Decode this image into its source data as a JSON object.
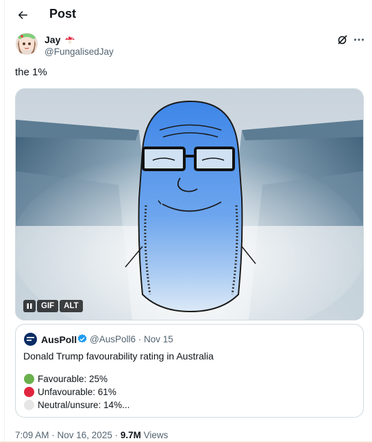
{
  "header": {
    "title": "Post"
  },
  "post": {
    "author": {
      "display_name": "Jay",
      "name_emoji": "mushroom",
      "handle": "@FungalisedJay"
    },
    "text": "the 1%",
    "media": {
      "type": "GIF",
      "alt_label": "ALT",
      "gif_label": "GIF",
      "icon": "pause-icon"
    },
    "quoted": {
      "display_name": "AusPoll",
      "verified": true,
      "handle_date": "@AusPoll6 · Nov 15",
      "text": "Donald Trump favourability rating in Australia",
      "options": [
        {
          "label": "Favourable: 25%",
          "color": "#6ab04c"
        },
        {
          "label": "Unfavourable: 61%",
          "color": "#e0263f"
        },
        {
          "label": "Neutral/unsure: 14%...",
          "color": "#e6e6e6"
        }
      ]
    },
    "meta": {
      "timestamp": "7:09 AM · Nov 16, 2025 · ",
      "views_count": "9.7M",
      "views_label": " Views"
    }
  },
  "colors": {
    "text": "#0f1419",
    "secondary": "#536471",
    "verified": "#1d9bf0",
    "border": "#cfd9de"
  }
}
